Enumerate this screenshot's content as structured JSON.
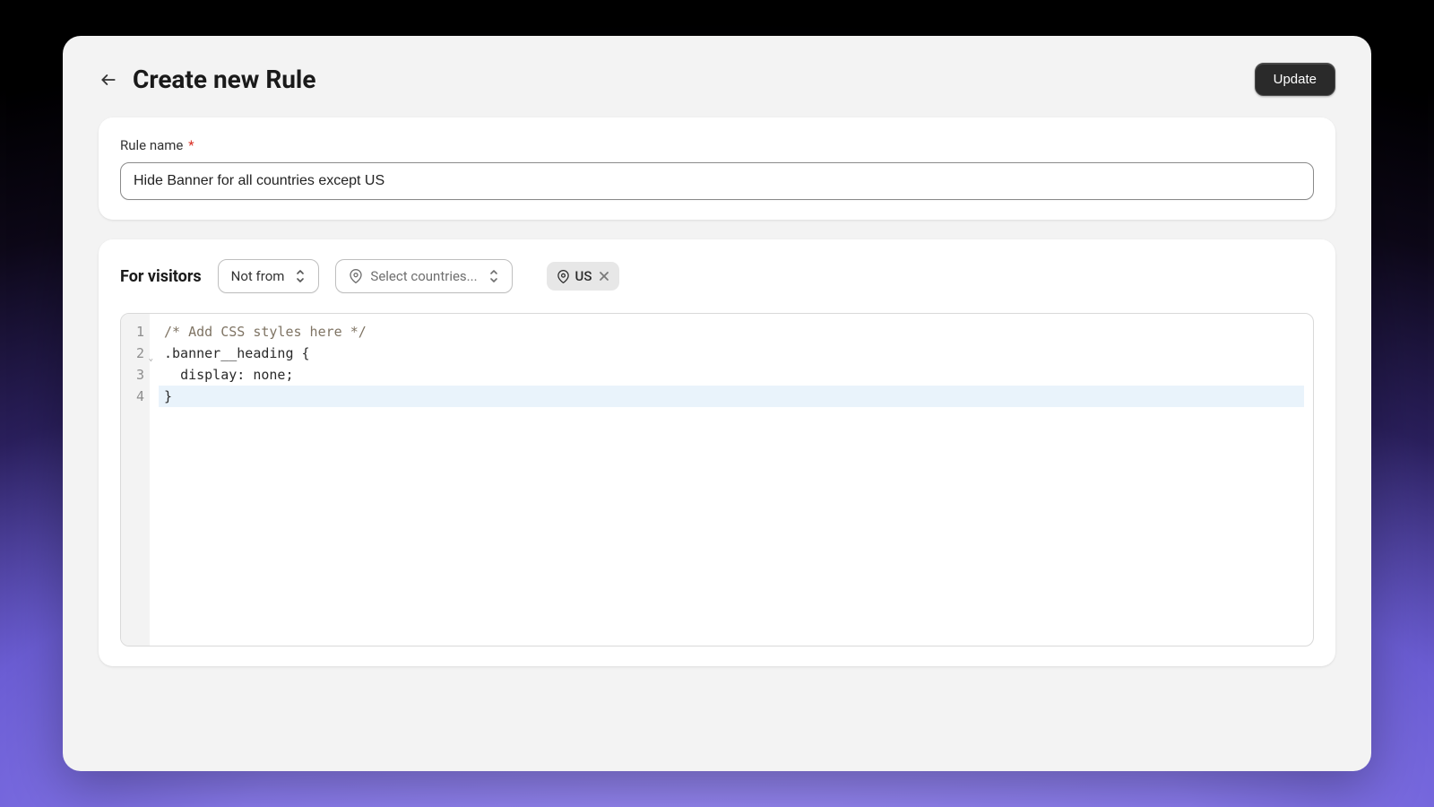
{
  "header": {
    "title": "Create new Rule",
    "update_label": "Update"
  },
  "rule_name": {
    "label": "Rule name",
    "required_marker": "*",
    "value": "Hide Banner for all countries except US"
  },
  "visitors": {
    "label": "For visitors",
    "condition_value": "Not from",
    "country_placeholder": "Select countries...",
    "chips": [
      {
        "label": "US"
      }
    ]
  },
  "editor": {
    "line_numbers": [
      "1",
      "2",
      "3",
      "4"
    ],
    "lines": [
      {
        "type": "comment",
        "text": "/* Add CSS styles here */"
      },
      {
        "type": "selector_open",
        "selector": ".banner__heading",
        "brace": " {"
      },
      {
        "type": "decl",
        "indent": "  ",
        "prop": "display",
        "colon": ": ",
        "value": "none",
        "semi": ";"
      },
      {
        "type": "brace_close",
        "text": "}"
      }
    ],
    "active_line_index": 3
  }
}
